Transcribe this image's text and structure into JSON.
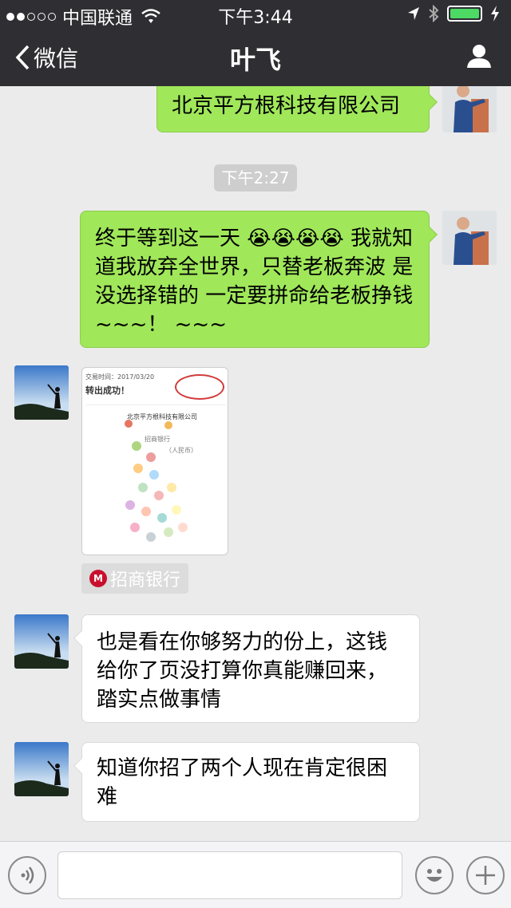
{
  "status_bar": {
    "carrier": "中国联通",
    "time": "下午3:44"
  },
  "nav": {
    "back_label": "微信",
    "title": "叶飞"
  },
  "messages": [
    {
      "sender": "me",
      "text": "北京平方根科技有限公司"
    },
    {
      "sender": "me",
      "text": "终于等到这一天 😭😭😭😭 我就知道我放弃全世界，只替老板奔波 是没选择错的 一定要拼命给老板挣钱~~~！ ~~~"
    },
    {
      "sender": "other",
      "text": "也是看在你够努力的份上，这钱给你了页没打算你真能赚回来，踏实点做事情"
    },
    {
      "sender": "other",
      "text": "知道你招了两个人现在肯定很困难"
    }
  ],
  "timestamp": "下午2:27",
  "receipt": {
    "date": "交易时间：2017/03/20",
    "title": "转出成功！",
    "payee_name": "北京平方根科技有限公司",
    "bank": "招商银行",
    "currency": "（人民币）"
  },
  "bank_tag": {
    "label": "招商银行"
  },
  "input": {
    "placeholder": ""
  },
  "colors": {
    "header": "#2e2e33",
    "bubble_green": "#a0e75a",
    "background": "#ebebeb"
  }
}
